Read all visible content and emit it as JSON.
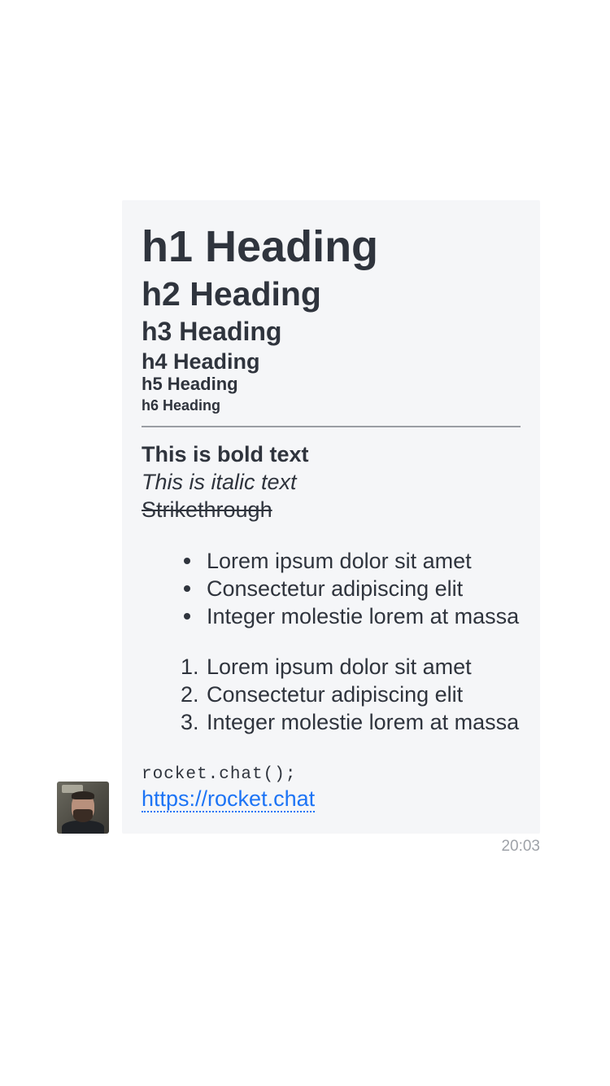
{
  "message": {
    "headings": {
      "h1": "h1 Heading",
      "h2": "h2 Heading",
      "h3": "h3 Heading",
      "h4": "h4 Heading",
      "h5": "h5 Heading",
      "h6": "h6 Heading"
    },
    "bold_text": "This is bold text",
    "italic_text": "This is italic text",
    "strike_text": "Strikethrough",
    "bullet_list": [
      "Lorem ipsum dolor sit amet",
      "Consectetur adipiscing elit",
      "Integer molestie lorem at massa"
    ],
    "ordered_list": [
      {
        "marker": "1.",
        "text": "Lorem ipsum dolor sit amet"
      },
      {
        "marker": "2.",
        "text": "Consectetur adipiscing elit"
      },
      {
        "marker": "3.",
        "text": "Integer molestie lorem at massa"
      }
    ],
    "code": "rocket.chat();",
    "link": "https://rocket.chat",
    "timestamp": "20:03"
  },
  "colors": {
    "text": "#2f343d",
    "bubble_background": "#f5f6f8",
    "link": "#1d74f5",
    "timestamp": "#9ea2a8"
  }
}
